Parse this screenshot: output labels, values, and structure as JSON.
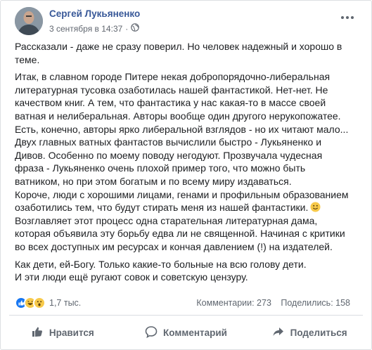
{
  "post": {
    "author": "Сергей Лукьяненко",
    "date": "3 сентября в 14:37",
    "separator": "·",
    "more_icon": "more-dots-icon",
    "privacy_icon": "globe-icon",
    "paragraphs": [
      [
        "Рассказали - даже не сразу поверил. Но человек надежный и хорошо в",
        "теме."
      ],
      [
        "Итак, в славном городе Питере некая добропорядочно-либеральная",
        "литературная тусовка озаботилась нашей фантастикой. Нет-нет. Не",
        "качеством книг. А тем, что фантастика у нас какая-то в массе своей",
        "ватная и нелиберальная. Авторы вообще один другого нерукопожатее.",
        "Есть, конечно, авторы ярко либеральной взглядов - но их читают мало...",
        "Двух главных ватных фантастов вычислили быстро - Лукьяненко и",
        "Дивов. Особенно по моему поводу негодуют. Прозвучала чудесная",
        "фраза - Лукьяненко очень плохой пример того, что можно быть",
        "ватником, но при этом богатым и по всему миру издаваться.",
        "Короче, люди с хорошими лицами, генами и профильным образованием",
        "озаботились тем, что будут стирать меня из нашей фантастики.",
        "Возглавляет этот процесс одна старательная литературная дама,",
        "которая объявила эту борьбу едва ли не священной. Начиная с критики",
        "во всех доступных им ресурсах и кончая давлением (!) на издателей."
      ],
      [
        "Как дети, ей-Богу. Только какие-то больные на всю голову дети.",
        "И эти люди ещё ругают совок и советскую цензуру."
      ]
    ]
  },
  "stats": {
    "reactions_count": "1,7 тыс.",
    "reaction_icons": [
      "like-icon",
      "haha-icon",
      "wow-icon"
    ],
    "comments": "Комментарии: 273",
    "shares": "Поделились: 158"
  },
  "actions": {
    "like": "Нравится",
    "comment": "Комментарий",
    "share": "Поделиться"
  },
  "colors": {
    "author": "#385898",
    "like_blue": "#1877f2",
    "reaction_yellow": "#f7c94a",
    "action_gray": "#606770"
  }
}
